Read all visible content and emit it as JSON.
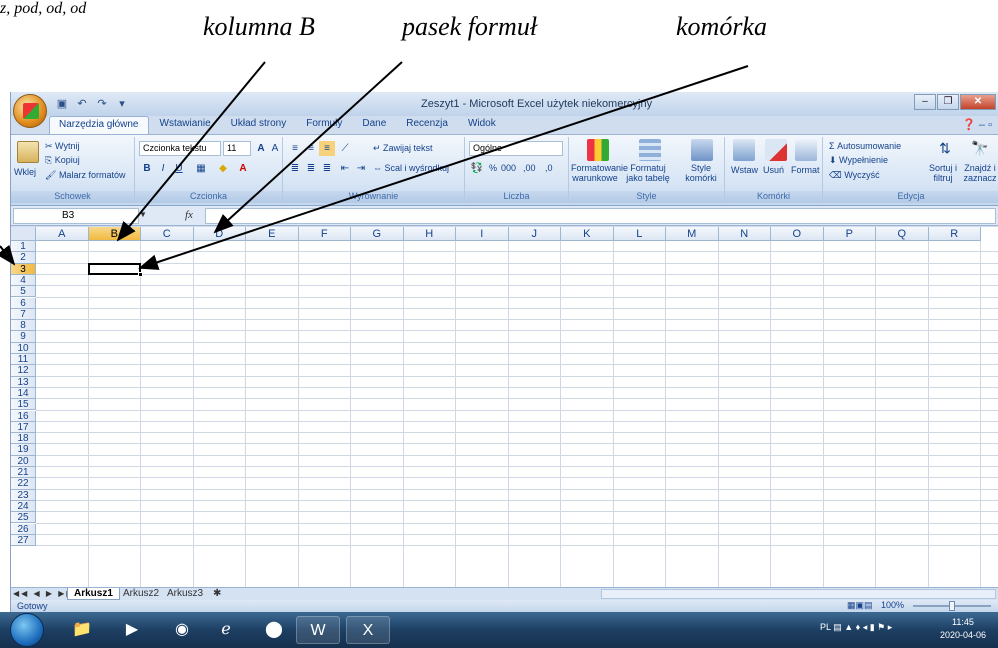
{
  "annotations": {
    "top_left_fragment": "z, pod, od, od",
    "column_b": "kolumna B",
    "formula_bar": "pasek formuł",
    "cell": "komórka"
  },
  "window": {
    "title": "Zeszyt1 - Microsoft Excel użytek niekomercyjny"
  },
  "ribbon": {
    "tabs": [
      "Narzędzia główne",
      "Wstawianie",
      "Układ strony",
      "Formuły",
      "Dane",
      "Recenzja",
      "Widok"
    ],
    "active_tab": "Narzędzia główne",
    "clipboard": {
      "paste": "Wklej",
      "cut": "Wytnij",
      "copy": "Kopiuj",
      "format_painter": "Malarz formatów",
      "label": "Schowek"
    },
    "font": {
      "font_name": "Czcionka tekstu",
      "font_size": "11",
      "label": "Czcionka"
    },
    "alignment": {
      "wrap": "Zawijaj tekst",
      "merge": "Scal i wyśrodkuj",
      "label": "Wyrównanie"
    },
    "number": {
      "format": "Ogólne",
      "percent": "%",
      "thousands": "000",
      "inc_decimal": ",00",
      "dec_decimal": ",0",
      "label": "Liczba"
    },
    "styles": {
      "conditional_line1": "Formatowanie",
      "conditional_line2": "warunkowe",
      "as_table_line1": "Formatuj",
      "as_table_line2": "jako tabelę",
      "cell_styles_line1": "Style",
      "cell_styles_line2": "komórki",
      "label": "Style"
    },
    "cells": {
      "insert": "Wstaw",
      "delete": "Usuń",
      "format": "Format",
      "label": "Komórki"
    },
    "editing": {
      "autosum": "Autosumowanie",
      "fill": "Wypełnienie",
      "clear": "Wyczyść",
      "sort_line1": "Sortuj i",
      "sort_line2": "filtruj",
      "find_line1": "Znajdź i",
      "find_line2": "zaznacz",
      "label": "Edycja"
    }
  },
  "formula_bar": {
    "name_box": "B3",
    "fx": "fx",
    "value": ""
  },
  "grid": {
    "columns": [
      "A",
      "B",
      "C",
      "D",
      "E",
      "F",
      "G",
      "H",
      "I",
      "J",
      "K",
      "L",
      "M",
      "N",
      "O",
      "P",
      "Q",
      "R"
    ],
    "rows": [
      "1",
      "2",
      "3",
      "4",
      "5",
      "6",
      "7",
      "8",
      "9",
      "10",
      "11",
      "12",
      "13",
      "14",
      "15",
      "16",
      "17",
      "18",
      "19",
      "20",
      "21",
      "22",
      "23",
      "24",
      "25",
      "26",
      "27"
    ],
    "selected_column": "B",
    "selected_row": "3"
  },
  "sheets": {
    "tabs": [
      "Arkusz1",
      "Arkusz2",
      "Arkusz3"
    ],
    "active": "Arkusz1"
  },
  "status": {
    "text": "Gotowy",
    "zoom": "100%"
  },
  "taskbar": {
    "language": "PL",
    "time": "11:45",
    "date": "2020-04-06"
  },
  "colors": {
    "selection_highlight": "#f1b941",
    "ribbon_bg": "#d4e3f4",
    "taskbar_bg": "#1d3f63"
  }
}
